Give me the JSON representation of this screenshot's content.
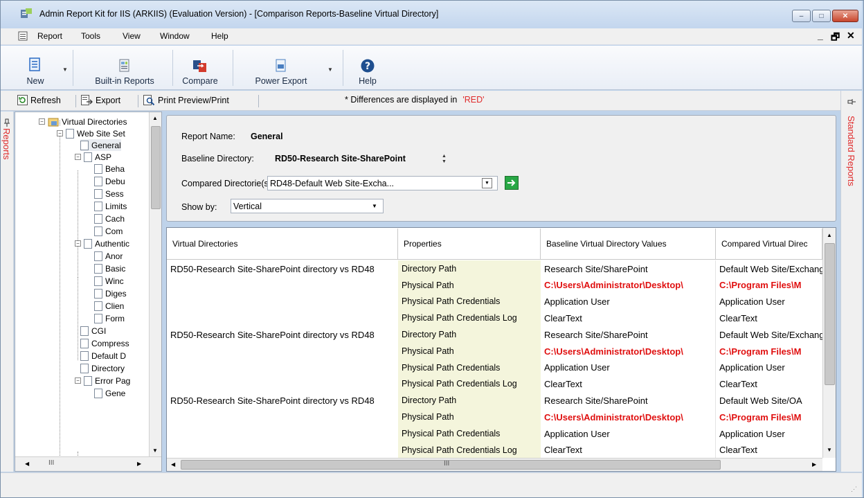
{
  "window": {
    "title": "Admin Report Kit for IIS (ARKIIS) (Evaluation Version) - [Comparison Reports-Baseline Virtual Directory]",
    "minimize": "–",
    "maximize": "□",
    "close": "✕"
  },
  "menu": {
    "items": [
      "Report",
      "Tools",
      "View",
      "Window",
      "Help"
    ],
    "mdi_min": "_",
    "mdi_restore": "🗗",
    "mdi_close": "✕"
  },
  "toolbar": {
    "new_label": "New",
    "builtin_label": "Built-in Reports",
    "compare_label": "Compare",
    "power_export_label": "Power Export",
    "help_label": "Help",
    "dropdown": "▼"
  },
  "subtoolbar": {
    "refresh_label": "Refresh",
    "export_label": "Export",
    "print_label": "Print Preview/Print",
    "note_prefix": "* Differences are displayed in",
    "note_red": "'RED'"
  },
  "side_tabs": {
    "left": "Reports",
    "right": "Standard Reports"
  },
  "tree": {
    "nodes": [
      {
        "label": "Virtual Directories",
        "fold": "−"
      },
      {
        "label": "Web Site Set",
        "fold": "−"
      },
      {
        "label": "General"
      },
      {
        "label": "ASP",
        "fold": "−"
      },
      {
        "label": "Beha"
      },
      {
        "label": "Debu"
      },
      {
        "label": "Sess"
      },
      {
        "label": "Limits"
      },
      {
        "label": "Cach"
      },
      {
        "label": "Com"
      },
      {
        "label": "Authentic",
        "fold": "−"
      },
      {
        "label": "Anor"
      },
      {
        "label": "Basic"
      },
      {
        "label": "Winc"
      },
      {
        "label": "Diges"
      },
      {
        "label": "Clien"
      },
      {
        "label": "Form"
      },
      {
        "label": "CGI"
      },
      {
        "label": "Compress"
      },
      {
        "label": "Default D"
      },
      {
        "label": "Directory"
      },
      {
        "label": "Error Pag",
        "fold": "−"
      },
      {
        "label": "Gene"
      }
    ],
    "hscroll_mid": "III"
  },
  "report": {
    "name_label": "Report Name:",
    "name_value": "General",
    "baseline_label": "Baseline Directory:",
    "baseline_value": "RD50-Research Site-SharePoint",
    "compared_label": "Compared Directorie(s):",
    "compared_value": "RD48-Default Web Site-Excha...",
    "showby_label": "Show by:",
    "showby_value": "Vertical"
  },
  "grid": {
    "columns": [
      "Virtual Directories",
      "Properties",
      "Baseline Virtual Directory Values",
      "Compared Virtual Direc"
    ],
    "groups": [
      {
        "vd": "RD50-Research Site-SharePoint directory vs RD48",
        "rows": [
          {
            "prop": "Directory Path",
            "base": "Research Site/SharePoint",
            "comp": "Default Web Site/Exchange",
            "diff": false
          },
          {
            "prop": "Physical Path",
            "base": "C:\\Users\\Administrator\\Desktop\\",
            "comp": "C:\\Program Files\\M",
            "diff": true
          },
          {
            "prop": "Physical Path Credentials",
            "base": "Application User",
            "comp": "Application User",
            "diff": false
          },
          {
            "prop": "Physical Path Credentials Log",
            "base": "ClearText",
            "comp": "ClearText",
            "diff": false
          }
        ]
      },
      {
        "vd": "RD50-Research Site-SharePoint directory vs RD48",
        "rows": [
          {
            "prop": "Directory Path",
            "base": "Research Site/SharePoint",
            "comp": "Default Web Site/Exchange",
            "diff": false
          },
          {
            "prop": "Physical Path",
            "base": "C:\\Users\\Administrator\\Desktop\\",
            "comp": "C:\\Program Files\\M",
            "diff": true
          },
          {
            "prop": "Physical Path Credentials",
            "base": "Application User",
            "comp": "Application User",
            "diff": false
          },
          {
            "prop": "Physical Path Credentials Log",
            "base": "ClearText",
            "comp": "ClearText",
            "diff": false
          }
        ]
      },
      {
        "vd": "RD50-Research Site-SharePoint directory vs RD48",
        "rows": [
          {
            "prop": "Directory Path",
            "base": "Research Site/SharePoint",
            "comp": "Default Web Site/OA",
            "diff": false
          },
          {
            "prop": "Physical Path",
            "base": "C:\\Users\\Administrator\\Desktop\\",
            "comp": "C:\\Program Files\\M",
            "diff": true
          },
          {
            "prop": "Physical Path Credentials",
            "base": "Application User",
            "comp": "Application User",
            "diff": false
          },
          {
            "prop": "Physical Path Credentials Log",
            "base": "ClearText",
            "comp": "ClearText",
            "diff": false
          }
        ]
      }
    ],
    "hscroll_mid": "III"
  },
  "colors": {
    "diff": "#e01010",
    "note": "#e02b2b",
    "prop_bg": "#f4f5dc"
  }
}
